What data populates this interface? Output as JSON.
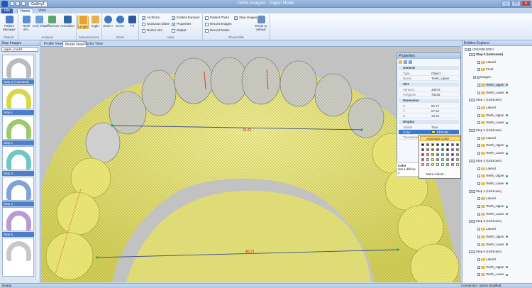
{
  "titlebar": {
    "doc_tab": "Gallery2",
    "window_title": "Ortho Analyzer - Digital Model"
  },
  "tabs": [
    "File",
    "Home",
    "View"
  ],
  "ribbon": {
    "patient": {
      "label": "Patient",
      "buttons": [
        "Patient Manager"
      ]
    },
    "analysis": {
      "label": "Analysis",
      "buttons": [
        "Teeth info.",
        "Arch info.",
        "Difference",
        "Animation"
      ]
    },
    "measurement": {
      "label": "Measurement",
      "buttons": [
        "Length",
        "Angle"
      ]
    },
    "zoom": {
      "label": "Zoom",
      "buttons": [
        "Zoom+",
        "Zoom-",
        "Fit"
      ]
    },
    "view": {
      "label": "View",
      "checks": [
        {
          "label": "Archform",
          "on": true
        },
        {
          "label": "Occlusion plane",
          "on": false
        },
        {
          "label": "Doctor Aim",
          "on": false
        },
        {
          "label": "Entities Explorer",
          "on": true
        },
        {
          "label": "Properties",
          "on": true
        },
        {
          "label": "Output",
          "on": false
        }
      ]
    },
    "showhide": {
      "label": "Show/Hide",
      "checks": [
        {
          "label": "Patient Photo",
          "on": false
        },
        {
          "label": "Record Images",
          "on": false
        },
        {
          "label": "Record Notes",
          "on": false
        },
        {
          "label": "Step Images",
          "on": true
        }
      ],
      "reset": "Reset to default"
    }
  },
  "left_panel": {
    "title": "Step Images",
    "combo": "upper_model",
    "steps": [
      "Step 0 (Activated)",
      "Step 1",
      "Step 2",
      "Step 3",
      "Step 4",
      "Step 5"
    ]
  },
  "view_tabs": [
    "Profile View",
    "Model View",
    "Doctor View"
  ],
  "measurements": {
    "top": "34.81",
    "bottom": "46.21"
  },
  "properties": {
    "title": "Properties",
    "general": {
      "header": "General",
      "rows": [
        [
          "Type",
          "Object"
        ],
        [
          "Name",
          "Teeth_Upper"
        ]
      ]
    },
    "size": {
      "header": "Size",
      "rows": [
        [
          "Vertices",
          "40872"
        ],
        [
          "Polygons",
          "78336"
        ]
      ]
    },
    "dimension": {
      "header": "Dimension",
      "rows": [
        [
          "X",
          "56.77"
        ],
        [
          "Y",
          "67.54"
        ],
        [
          "Z",
          "12.54"
        ]
      ]
    },
    "display": {
      "header": "Display",
      "rows": [
        [
          "Visible",
          "True"
        ],
        [
          "Color",
          "FFFF00"
        ],
        [
          "Transparency",
          ""
        ]
      ]
    },
    "desc_title": "Color",
    "desc_text": "Set a diffuse c"
  },
  "color_popup": {
    "auto": "Automatic Color",
    "more": "More Colors..."
  },
  "explorer": {
    "title": "Entities Explorer",
    "root": "<20110511001>",
    "items": [
      {
        "t": "Step 0 (Unknown)",
        "lvl": 1,
        "bold": true
      },
      {
        "t": "Lateral",
        "lvl": 3
      },
      {
        "t": "Front",
        "lvl": 3
      },
      {
        "t": "Images",
        "lvl": 2
      },
      {
        "t": "Teeth_Upper",
        "lvl": 3,
        "sel": true
      },
      {
        "t": "Teeth_Lower",
        "lvl": 3
      },
      {
        "t": "Step 1 (Unknown)",
        "lvl": 1
      },
      {
        "t": "Lateral",
        "lvl": 3
      },
      {
        "t": "Teeth_Upper",
        "lvl": 3
      },
      {
        "t": "Teeth_Lower",
        "lvl": 3
      },
      {
        "t": "Step 2 (Unknown)",
        "lvl": 1
      },
      {
        "t": "Lateral",
        "lvl": 3
      },
      {
        "t": "Teeth_Upper",
        "lvl": 3
      },
      {
        "t": "Teeth_Lower",
        "lvl": 3
      },
      {
        "t": "Step 3 (Unknown)",
        "lvl": 1
      },
      {
        "t": "Lateral",
        "lvl": 3
      },
      {
        "t": "Teeth_Upper",
        "lvl": 3
      },
      {
        "t": "Teeth_Lower",
        "lvl": 3
      },
      {
        "t": "Step 4 (Unknown)",
        "lvl": 1
      },
      {
        "t": "Lateral",
        "lvl": 3
      },
      {
        "t": "Teeth_Upper",
        "lvl": 3
      },
      {
        "t": "Teeth_Lower",
        "lvl": 3
      },
      {
        "t": "Step 5 (Unknown)",
        "lvl": 1
      },
      {
        "t": "Lateral",
        "lvl": 3
      },
      {
        "t": "Teeth_Upper",
        "lvl": 3
      },
      {
        "t": "Teeth_Lower",
        "lvl": 3
      },
      {
        "t": "Step 6 (Unknown)",
        "lvl": 1
      },
      {
        "t": "Lateral",
        "lvl": 3
      },
      {
        "t": "Teeth_Upper",
        "lvl": 3
      },
      {
        "t": "Teeth_Lower",
        "lvl": 3
      }
    ]
  },
  "status": {
    "left": "Ready",
    "right": "Connected - admin Modified"
  }
}
